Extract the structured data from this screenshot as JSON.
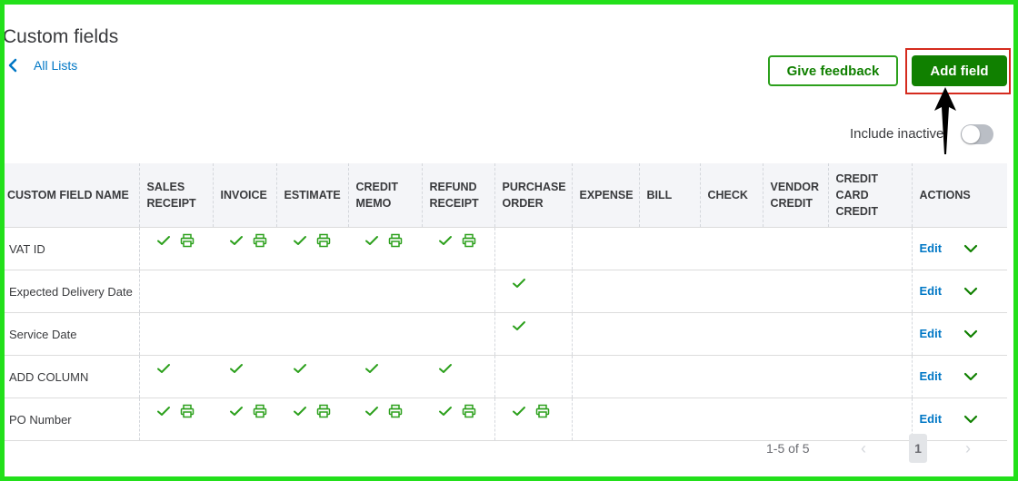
{
  "page": {
    "title": "Custom fields",
    "back_label": "All Lists"
  },
  "toolbar": {
    "feedback_label": "Give feedback",
    "add_label": "Add field",
    "include_inactive_label": "Include inactive",
    "include_inactive_on": false
  },
  "colors": {
    "accent_green": "#108000",
    "link_blue": "#0077c5",
    "border_highlight": "#d52b1e",
    "frame_green": "#22e01a",
    "check_green": "#2ca01c"
  },
  "table": {
    "headers": {
      "name": "CUSTOM FIELD NAME",
      "sales_receipt": [
        "SALES",
        "RECEIPT"
      ],
      "invoice": "INVOICE",
      "estimate": "ESTIMATE",
      "credit_memo": [
        "CREDIT",
        "MEMO"
      ],
      "refund_receipt": [
        "REFUND",
        "RECEIPT"
      ],
      "purchase_order": [
        "PURCHASE",
        "ORDER"
      ],
      "expense": "EXPENSE",
      "bill": "BILL",
      "check": "CHECK",
      "vendor_credit": [
        "VENDOR",
        "CREDIT"
      ],
      "credit_card_credit": [
        "CREDIT",
        "CARD",
        "CREDIT"
      ],
      "actions": "ACTIONS"
    },
    "edit_label": "Edit",
    "rows": [
      {
        "name": "VAT ID"
      },
      {
        "name": "Expected Delivery Date"
      },
      {
        "name": "Service Date"
      },
      {
        "name": "ADD COLUMN"
      },
      {
        "name": "PO Number"
      }
    ]
  },
  "pagination": {
    "range": "1-5 of 5",
    "current_page": "1"
  },
  "icons": {
    "check": "check-icon",
    "print": "print-icon",
    "chevron": "chevron-down-icon",
    "back": "chevron-left-icon"
  }
}
